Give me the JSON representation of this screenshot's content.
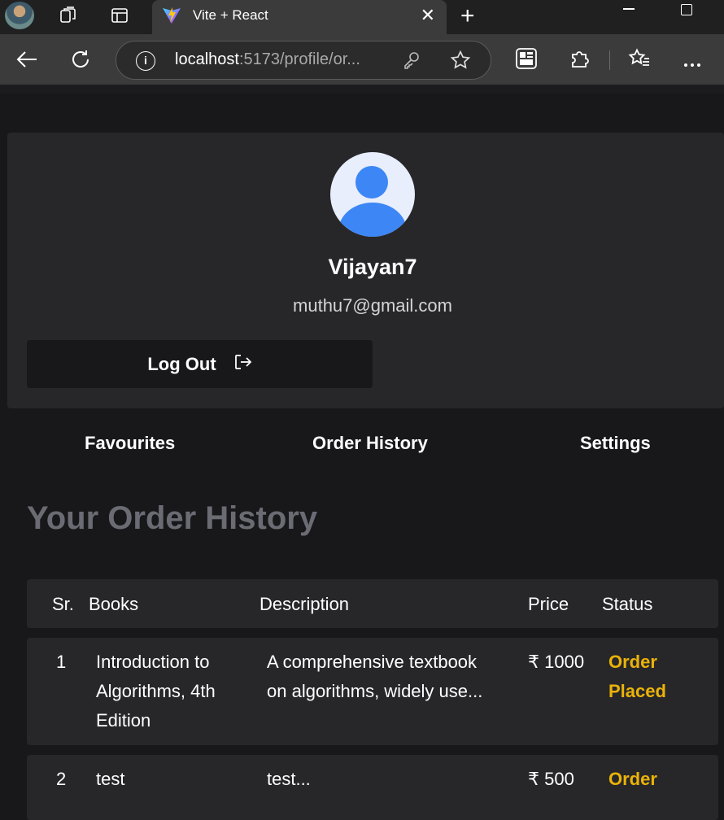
{
  "browser": {
    "tab_title": "Vite + React",
    "url_host": "localhost",
    "url_rest": ":5173/profile/or..."
  },
  "profile": {
    "username": "Vijayan7",
    "email": "muthu7@gmail.com",
    "logout_label": "Log Out"
  },
  "subnav": {
    "items": [
      "Favourites",
      "Order History",
      "Settings"
    ]
  },
  "orders": {
    "title": "Your Order History",
    "columns": [
      "Sr.",
      "Books",
      "Description",
      "Price",
      "Status"
    ],
    "rows": [
      {
        "sr": "1",
        "book_lines": [
          "Introduction to",
          "Algorithms, 4th",
          "Edition"
        ],
        "desc_lines": [
          "A comprehensive textbook",
          "on algorithms, widely use..."
        ],
        "price": "₹ 1000",
        "status_lines": [
          "Order",
          "Placed"
        ]
      },
      {
        "sr": "2",
        "book_lines": [
          "test"
        ],
        "desc_lines": [
          "test..."
        ],
        "price": "₹ 500",
        "status_lines": [
          "Order"
        ]
      }
    ]
  },
  "colors": {
    "page_bg": "#18181b",
    "card_bg": "#27272a",
    "status_accent": "#eab308",
    "avatar_blue": "#3d86f5"
  }
}
